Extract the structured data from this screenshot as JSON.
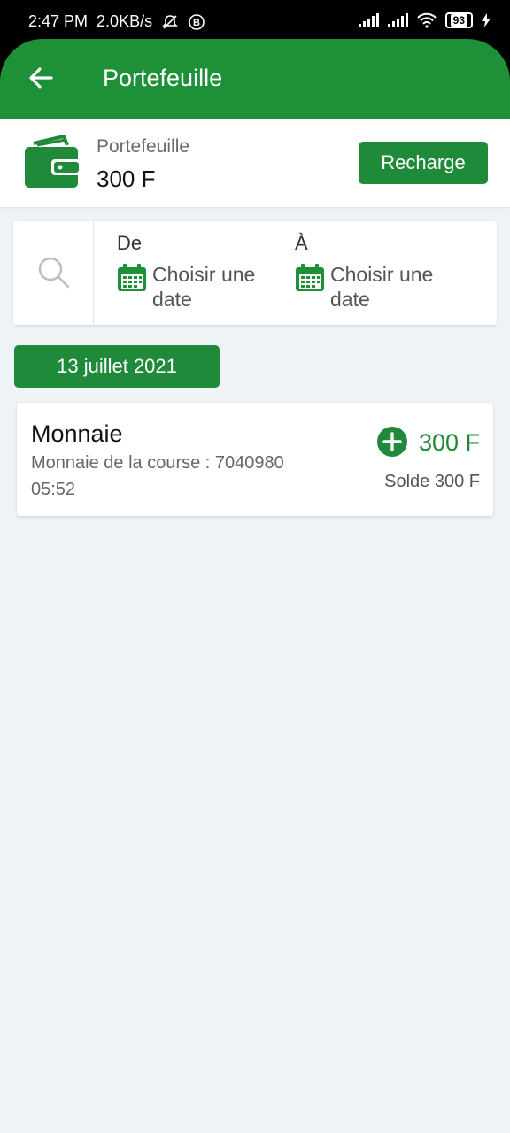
{
  "status_bar": {
    "time": "2:47 PM",
    "speed": "2.0KB/s",
    "battery": "93"
  },
  "header": {
    "title": "Portefeuille"
  },
  "wallet": {
    "label": "Portefeuille",
    "amount": "300 F",
    "recharge_label": "Recharge"
  },
  "filter": {
    "from_label": "De",
    "from_placeholder": "Choisir une date",
    "to_label": "À",
    "to_placeholder": "Choisir une date"
  },
  "transactions": {
    "date": "13 juillet 2021",
    "items": [
      {
        "title": "Monnaie",
        "description": "Monnaie de la course : 7040980",
        "time": "05:52",
        "amount": "300 F",
        "balance": "Solde 300 F"
      }
    ]
  },
  "colors": {
    "primary": "#1e9138",
    "accent": "#1e8a3a",
    "background": "#eef3f6"
  }
}
